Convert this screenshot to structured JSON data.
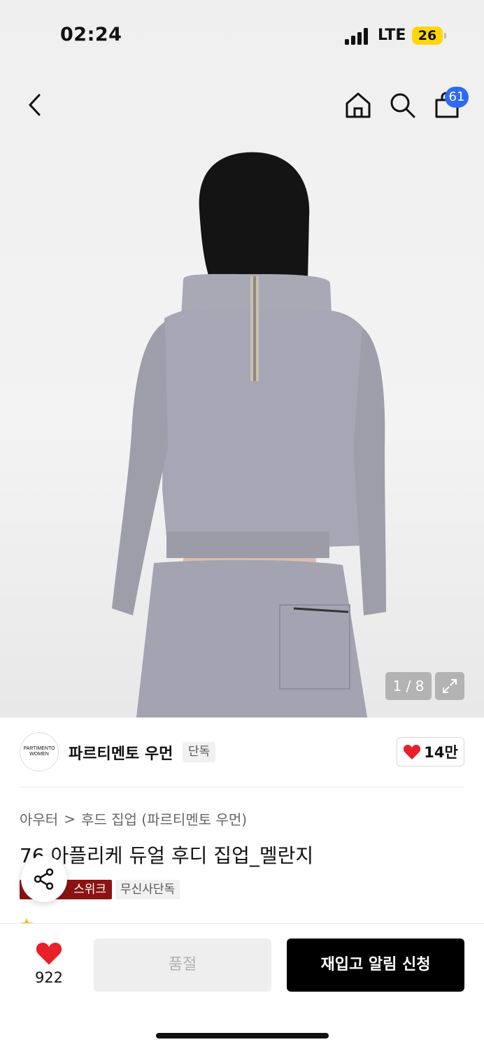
{
  "status_bar": {
    "time": "02:24",
    "network": "LTE",
    "battery": "26"
  },
  "nav": {
    "cart_count": "61"
  },
  "gallery": {
    "counter": "1 / 8"
  },
  "brand": {
    "logo_text_line1": "PARTIMENTO",
    "logo_text_line2": "WOMEN",
    "name": "파르티멘토 우먼",
    "exclusive_tag": "단독",
    "likes": "14만"
  },
  "breadcrumb": {
    "category": "아우터",
    "separator": ">",
    "subcategory": "후드 집업 (파르티멘토 우먼)"
  },
  "product": {
    "title": "76 아플리케 듀얼 후디 집업_멜란지",
    "tag_red": "스위크",
    "tag_gray": "무신사단독"
  },
  "bottom_bar": {
    "heart_count": "922",
    "soldout_label": "품절",
    "restock_label": "재입고 알림 신청"
  },
  "colors": {
    "accent_red": "#e8202a",
    "badge_blue": "#2e6bf0",
    "tag_red": "#8b1313",
    "battery_yellow": "#ffd60a"
  }
}
